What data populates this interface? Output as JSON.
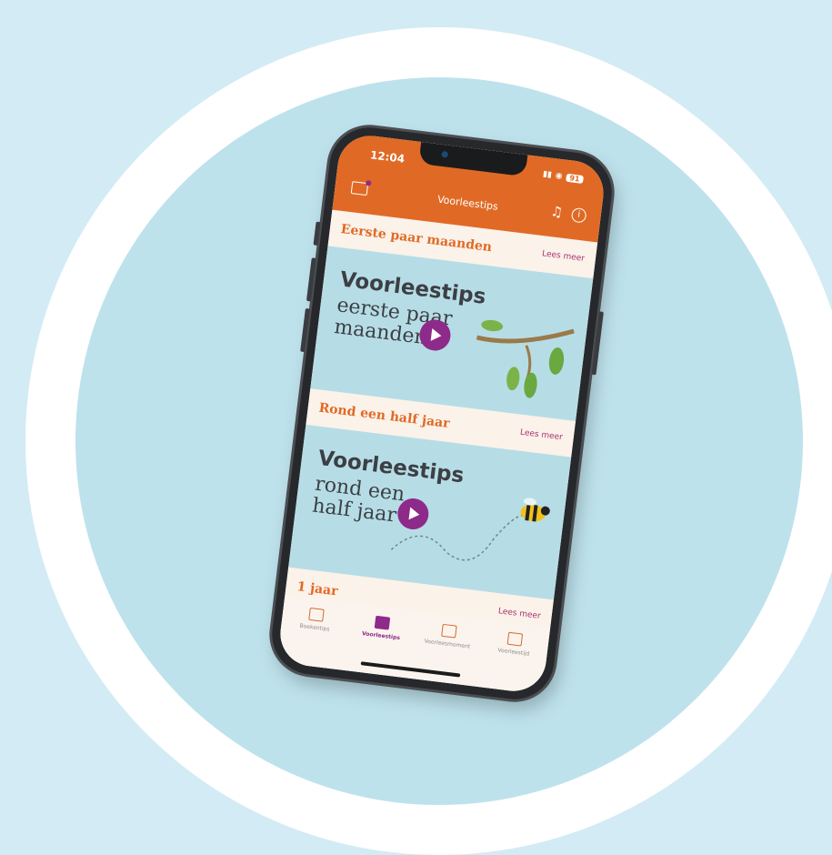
{
  "status": {
    "time": "12:04",
    "battery": "91"
  },
  "header": {
    "title": "Voorleestips"
  },
  "sections": [
    {
      "title": "Eerste paar maanden",
      "more": "Lees meer",
      "card_title": "Voorleestips",
      "card_sub_1": "eerste paar",
      "card_sub_2": "maanden"
    },
    {
      "title": "Rond een half jaar",
      "more": "Lees meer",
      "card_title": "Voorleestips",
      "card_sub_1": "rond een",
      "card_sub_2": "half jaar"
    },
    {
      "title": "1 jaar",
      "more": "Lees meer"
    }
  ],
  "tabs": [
    {
      "label": "Boekentips",
      "icon": "book-icon",
      "active": false
    },
    {
      "label": "Voorleestips",
      "icon": "gift-icon",
      "active": true
    },
    {
      "label": "Voorleesmoment",
      "icon": "photo-icon",
      "active": false
    },
    {
      "label": "Voorleestijd",
      "icon": "bear-icon",
      "active": false
    }
  ],
  "colors": {
    "accent": "#e06a25",
    "brand": "#8e2a8a",
    "background": "#bee2ec"
  }
}
